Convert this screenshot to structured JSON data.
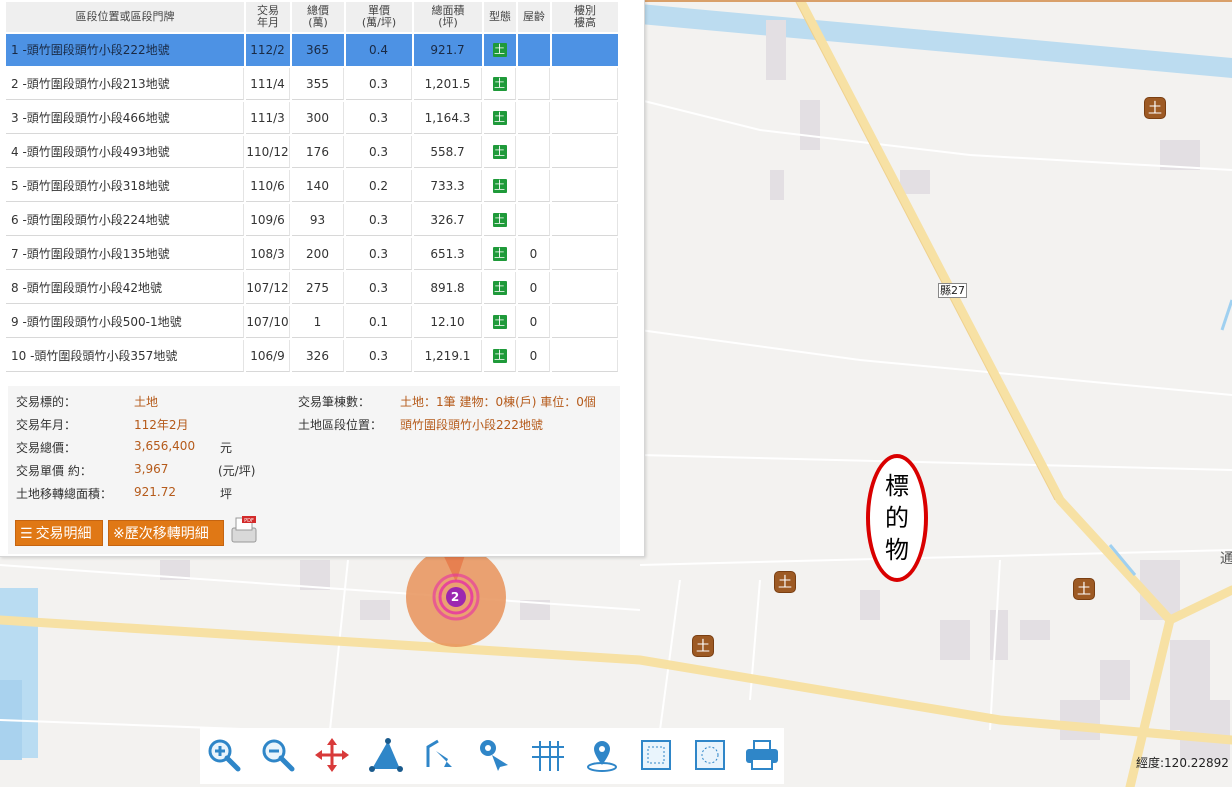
{
  "table": {
    "headers": {
      "address": "區段位置或區段門牌",
      "date_1": "交易",
      "date_2": "年月",
      "total_1": "總價",
      "total_2": "(萬)",
      "unit_1": "單價",
      "unit_2": "(萬/坪)",
      "area_1": "總面積",
      "area_2": "(坪)",
      "type": "型態",
      "age": "屋齡",
      "floor_1": "樓別",
      "floor_2": "樓高"
    },
    "rows": [
      {
        "address": "1 -頭竹圍段頭竹小段222地號",
        "date": "112/2",
        "total": "365",
        "unit": "0.4",
        "area": "921.7",
        "type": "土",
        "age": "",
        "floor": ""
      },
      {
        "address": "2 -頭竹圍段頭竹小段213地號",
        "date": "111/4",
        "total": "355",
        "unit": "0.3",
        "area": "1,201.5",
        "type": "土",
        "age": "",
        "floor": ""
      },
      {
        "address": "3 -頭竹圍段頭竹小段466地號",
        "date": "111/3",
        "total": "300",
        "unit": "0.3",
        "area": "1,164.3",
        "type": "土",
        "age": "",
        "floor": ""
      },
      {
        "address": "4 -頭竹圍段頭竹小段493地號",
        "date": "110/12",
        "total": "176",
        "unit": "0.3",
        "area": "558.7",
        "type": "土",
        "age": "",
        "floor": ""
      },
      {
        "address": "5 -頭竹圍段頭竹小段318地號",
        "date": "110/6",
        "total": "140",
        "unit": "0.2",
        "area": "733.3",
        "type": "土",
        "age": "",
        "floor": ""
      },
      {
        "address": "6 -頭竹圍段頭竹小段224地號",
        "date": "109/6",
        "total": "93",
        "unit": "0.3",
        "area": "326.7",
        "type": "土",
        "age": "",
        "floor": ""
      },
      {
        "address": "7 -頭竹圍段頭竹小段135地號",
        "date": "108/3",
        "total": "200",
        "unit": "0.3",
        "area": "651.3",
        "type": "土",
        "age": "0",
        "floor": ""
      },
      {
        "address": "8 -頭竹圍段頭竹小段42地號",
        "date": "107/12",
        "total": "275",
        "unit": "0.3",
        "area": "891.8",
        "type": "土",
        "age": "0",
        "floor": ""
      },
      {
        "address": "9 -頭竹圍段頭竹小段500-1地號",
        "date": "107/10",
        "total": "1",
        "unit": "0.1",
        "area": "12.10",
        "type": "土",
        "age": "0",
        "floor": ""
      },
      {
        "address": "10 -頭竹圍段頭竹小段357地號",
        "date": "106/9",
        "total": "326",
        "unit": "0.3",
        "area": "1,219.1",
        "type": "土",
        "age": "0",
        "floor": ""
      }
    ]
  },
  "summary": {
    "target_label": "交易標的：",
    "target_value": "土地",
    "month_label": "交易年月：",
    "month_value": "112年2月",
    "total_label": "交易總價：",
    "total_value": "3,656,400",
    "total_unit": "元",
    "unitprice_label": "交易單價 約：",
    "unitprice_value": "3,967",
    "unitprice_unit": "(元/坪)",
    "area_label": "土地移轉總面積：",
    "area_value": "921.72",
    "area_unit": "坪",
    "count_label": "交易筆棟數：",
    "count_value": "土地：1筆 建物：0棟(戶) 車位：0個",
    "location_label": "土地區段位置：",
    "location_value": "頭竹圍段頭竹小段222地號"
  },
  "buttons": {
    "detail": "交易明細",
    "history": "※歷次移轉明細"
  },
  "map": {
    "road_label": "縣27",
    "cluster_count": "2",
    "landmark_char": "土",
    "annotation_chars": [
      "標",
      "的",
      "物"
    ],
    "coordinate": "經度:120.22892",
    "edge_text": "通"
  },
  "toolbar": {
    "tools": [
      "zoom-in-icon",
      "zoom-out-icon",
      "pan-icon",
      "measure-area-icon",
      "select-icon",
      "locate-pin-icon",
      "road-grid-icon",
      "location-icon",
      "extent-icon",
      "full-extent-icon",
      "print-icon"
    ]
  },
  "colors": {
    "selected_row": "#4d92e4",
    "value_text": "#b55a1a",
    "button": "#e07815",
    "land_badge": "#1f9a3a",
    "arrow": "#e11414",
    "annotation_ring": "#d90000"
  }
}
